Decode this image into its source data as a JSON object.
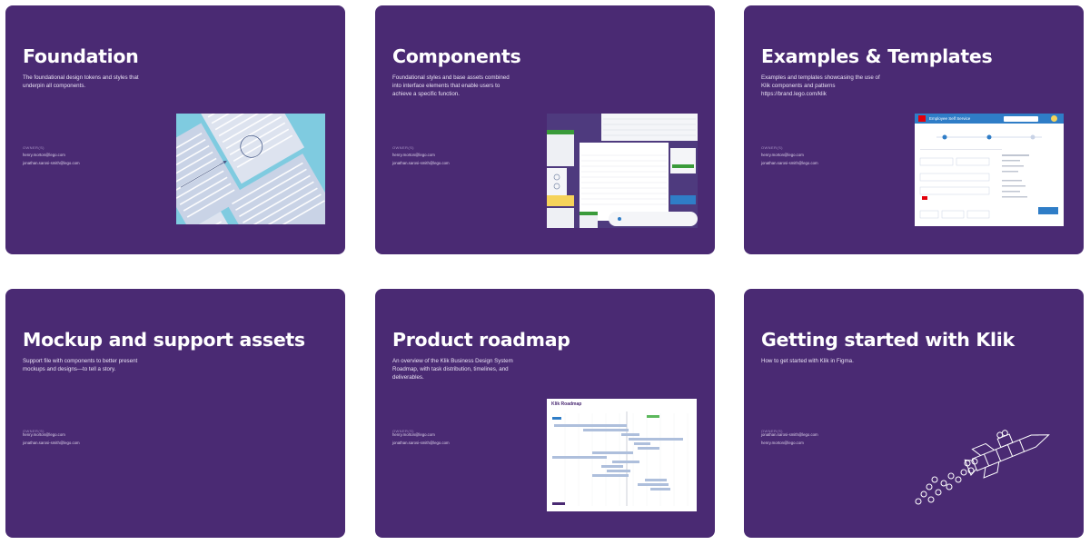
{
  "cards": [
    {
      "title": "Foundation",
      "description": "The foundational design tokens and styles that underpin all components.",
      "owners_label": "OWNER(S)",
      "owners": [
        "henry.morton@lego.com",
        "jonathan.sarosi-smith@lego.com"
      ]
    },
    {
      "title": "Components",
      "description": "Foundational styles and base assets combined into interface elements that enable users to achieve a specific function.",
      "owners_label": "OWNER(S)",
      "owners": [
        "henry.morton@lego.com",
        "jonathan.sarosi-smith@lego.com"
      ]
    },
    {
      "title": "Examples & Templates",
      "description": "Examples and templates showcasing the use of Klik components and patterns https://brand.lego.com/klik",
      "owners_label": "OWNER(S)",
      "owners": [
        "henry.morton@lego.com",
        "jonathan.sarosi-smith@lego.com"
      ]
    },
    {
      "title": "Mockup and support assets",
      "description": "Support file with components to better present mockups and designs—to tell a story.",
      "owners_label": "OWNER(S)",
      "owners": [
        "henry.morton@lego.com",
        "jonathan.sarosi-smith@lego.com"
      ]
    },
    {
      "title": "Product roadmap",
      "description": "An overview of the Klik Business Design System Roadmap, with task distribution, timelines, and deliverables.",
      "owners_label": "OWNER(S)",
      "owners": [
        "henry.morton@lego.com",
        "jonathan.sarosi-smith@lego.com"
      ]
    },
    {
      "title": "Getting started with Klik",
      "description": "How to get started with Klik in Figma.",
      "owners_label": "OWNER(S)",
      "owners": [
        "jonathan.sarosi-smith@lego.com",
        "henry.morton@lego.com"
      ]
    }
  ],
  "thumbnails": {
    "examples_header": "Employee Self Service",
    "roadmap_header": "Klik Roadmap"
  },
  "colors": {
    "card_bg": "#4a2a73",
    "lego_red": "#e3000b",
    "accent_blue": "#2f7dc7"
  }
}
